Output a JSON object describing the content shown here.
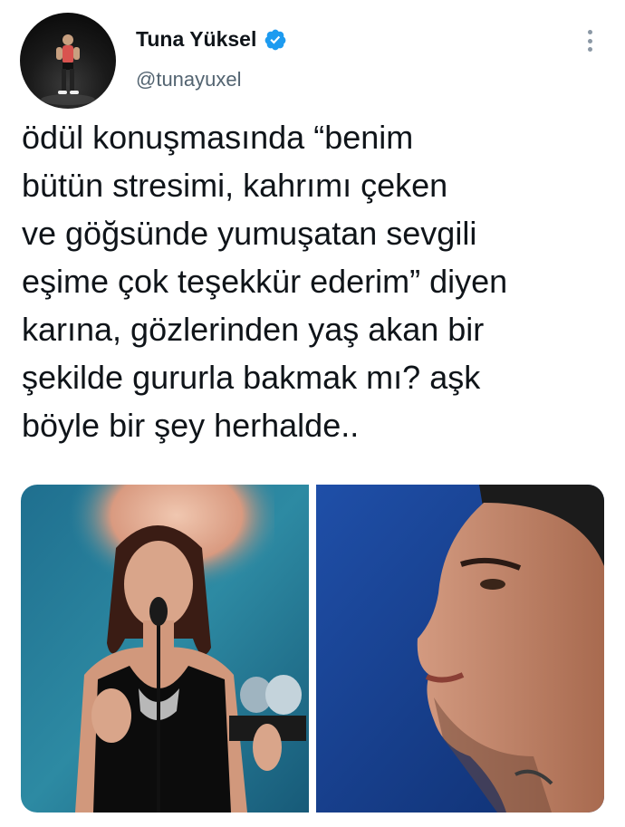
{
  "tweet": {
    "author": {
      "display_name": "Tuna Yüksel",
      "handle": "@tunayuxel",
      "verified": true
    },
    "text_lines": [
      "ödül konuşmasında “benim",
      "bütün stresimi, kahrımı çeken",
      "ve göğsünde yumuşatan sevgili",
      "eşime çok teşekkür ederim” diyen",
      "karına, gözlerinden yaş akan bir",
      "şekilde gururla bakmak mı? aşk",
      "böyle bir şey herhalde.."
    ],
    "media": [
      {
        "icon": "photo-woman-on-stage-with-award"
      },
      {
        "icon": "photo-man-profile-closeup"
      }
    ]
  },
  "colors": {
    "text": "#0f1419",
    "secondary_text": "#536471",
    "verified_blue": "#1d9bf0",
    "more_dots": "#8b98a5"
  }
}
